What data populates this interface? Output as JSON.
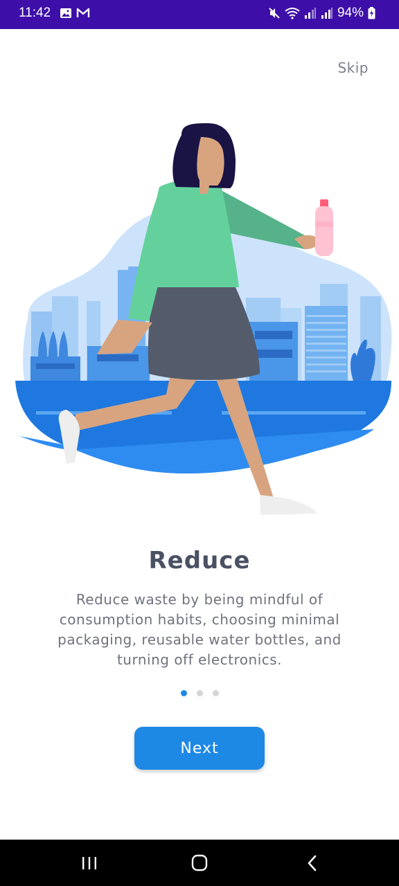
{
  "status_bar": {
    "time": "11:42",
    "battery": "94%",
    "icons": [
      "image-icon",
      "gmail-icon",
      "mute-icon",
      "wifi-icon",
      "signal-icon",
      "signal-icon",
      "battery-charging-icon"
    ]
  },
  "header": {
    "skip_label": "Skip"
  },
  "onboarding": {
    "title": "Reduce",
    "description": "Reduce waste by being mindful of consumption habits, choosing minimal packaging, reusable water bottles, and turning off electronics.",
    "page_count": 3,
    "current_page": 1
  },
  "actions": {
    "next_label": "Next"
  },
  "colors": {
    "accent": "#1e88e5",
    "status_bar": "#3d0fa8",
    "title": "#4a5163"
  },
  "navigation": {
    "buttons": [
      "recent-apps-icon",
      "home-icon",
      "back-icon"
    ]
  }
}
